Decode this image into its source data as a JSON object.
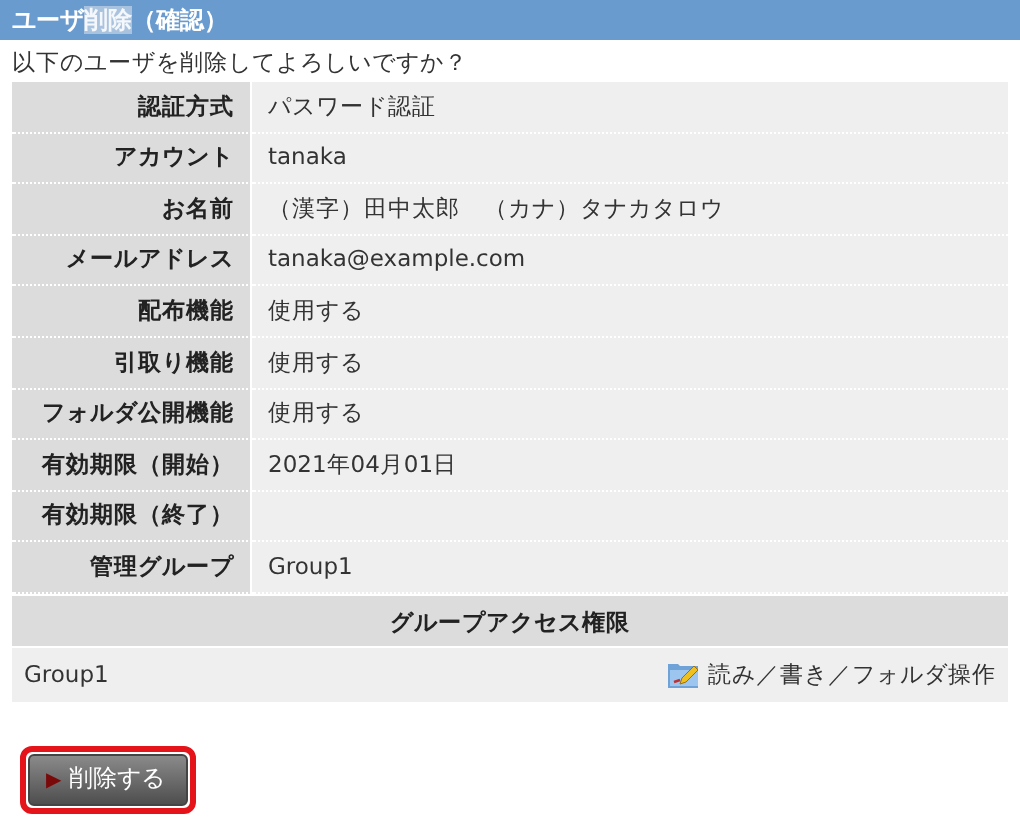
{
  "title": {
    "segments": [
      {
        "text": "ユーザ",
        "highlighted": false
      },
      {
        "text": "削除",
        "highlighted": true
      },
      {
        "text": "（確認）",
        "highlighted": false
      }
    ]
  },
  "question": "以下のユーザを削除してよろしいですか？",
  "fields": [
    {
      "label": "認証方式",
      "value": "パスワード認証"
    },
    {
      "label": "アカウント",
      "value": "tanaka"
    },
    {
      "label": "お名前",
      "value": "（漢字）田中太郎　（カナ）タナカタロウ"
    },
    {
      "label": "メールアドレス",
      "value": "tanaka@example.com"
    },
    {
      "label": "配布機能",
      "value": "使用する"
    },
    {
      "label": "引取り機能",
      "value": "使用する"
    },
    {
      "label": "フォルダ公開機能",
      "value": "使用する"
    },
    {
      "label": "有効期限（開始）",
      "value": "2021年04月01日"
    },
    {
      "label": "有効期限（終了）"
    },
    {
      "label": "管理グループ",
      "value": "Group1"
    }
  ],
  "group_access": {
    "heading": "グループアクセス権限",
    "rows": [
      {
        "group": "Group1",
        "permission": "読み／書き／フォルダ操作"
      }
    ]
  },
  "delete_button": {
    "arrow": "▶",
    "label": "削除する",
    "focused": true
  }
}
